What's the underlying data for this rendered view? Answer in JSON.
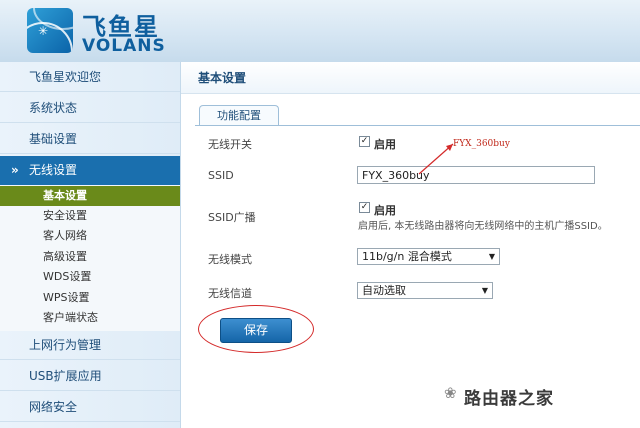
{
  "brand": {
    "cn": "飞鱼星",
    "en": "VOLANS"
  },
  "sidebar": {
    "items_top": [
      "飞鱼星欢迎您",
      "系统状态",
      "基础设置"
    ],
    "active_group": "无线设置",
    "sub_items": [
      "基本设置",
      "安全设置",
      "客人网络",
      "高级设置",
      "WDS设置",
      "WPS设置",
      "客户端状态"
    ],
    "current_sub": "基本设置",
    "items_bottom": [
      "上网行为管理",
      "USB扩展应用",
      "网络安全"
    ]
  },
  "page": {
    "title": "基本设置",
    "tab": "功能配置"
  },
  "form": {
    "wireless_switch": {
      "label": "无线开关",
      "checked": true,
      "option": "启用"
    },
    "ssid": {
      "label": "SSID",
      "value": "FYX_360buy"
    },
    "ssid_broadcast": {
      "label": "SSID广播",
      "checked": true,
      "option": "启用",
      "hint": "启用后, 本无线路由器将向无线网络中的主机广播SSID。"
    },
    "wireless_mode": {
      "label": "无线模式",
      "value": "11b/g/n 混合模式"
    },
    "wireless_channel": {
      "label": "无线信道",
      "value": "自动选取"
    },
    "save_label": "保存"
  },
  "annotation": {
    "text": "FYX_360buy",
    "color": "#d42a2a"
  },
  "watermark": {
    "text": "路由器之家"
  },
  "colors": {
    "accent": "#1a6fae",
    "current_sub": "#6a8a1a",
    "annotation": "#d42a2a"
  }
}
